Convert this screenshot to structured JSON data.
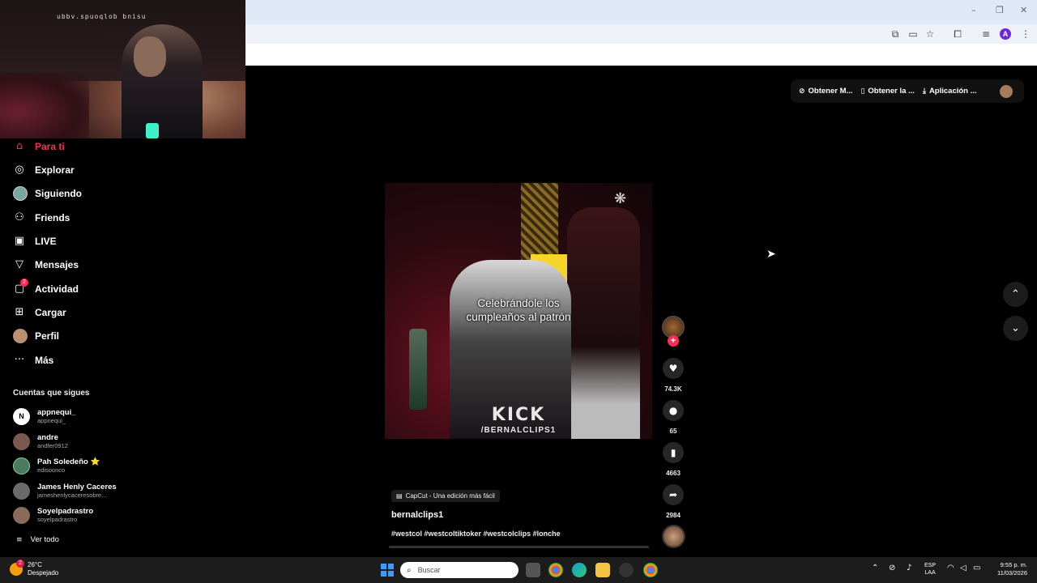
{
  "browser": {
    "window_controls": {
      "minimize": "–",
      "restore": "❐",
      "close": "✕"
    },
    "profile_initial": "A"
  },
  "webcam": {
    "overlay_text": "ubbv.spuoqlob bnisu"
  },
  "sidebar": {
    "items": [
      {
        "label": "Para ti",
        "icon": "home-icon",
        "active": true
      },
      {
        "label": "Explorar",
        "icon": "compass-icon"
      },
      {
        "label": "Siguiendo",
        "icon": "following-avatar-icon"
      },
      {
        "label": "Friends",
        "icon": "friends-icon"
      },
      {
        "label": "LIVE",
        "icon": "live-icon"
      },
      {
        "label": "Mensajes",
        "icon": "send-icon"
      },
      {
        "label": "Actividad",
        "icon": "activity-icon",
        "badge": "2"
      },
      {
        "label": "Cargar",
        "icon": "upload-icon"
      },
      {
        "label": "Perfil",
        "icon": "profile-avatar-icon"
      },
      {
        "label": "Más",
        "icon": "more-icon"
      }
    ],
    "following_title": "Cuentas que sigues",
    "accounts": [
      {
        "name": "appnequi_",
        "handle": "appnequi_",
        "avatar_text": "N"
      },
      {
        "name": "andre",
        "handle": "andfer0912"
      },
      {
        "name": "Pah Soledeño ⭐",
        "handle": "edisoonco"
      },
      {
        "name": "James Henly Caceres",
        "handle": "jameshenlycaceresobre..."
      },
      {
        "name": "Soyelpadrastro",
        "handle": "soyelpadrastro"
      }
    ],
    "see_all": "Ver todo"
  },
  "top_actions": {
    "get_coins": "Obtener M...",
    "get_app": "Obtener la ...",
    "pc_app": "Aplicación ..."
  },
  "video": {
    "caption": "Celebrándole los\ncumpleaños al patrón",
    "watermark_main": "KICK",
    "watermark_sub": "/BERNALCLIPS1",
    "capcut_label": "CapCut - Una edición más fácil",
    "author": "bernalclips1",
    "hashtags": "#westcol #westcoltiktoker #westcolclips #lonche",
    "progress": 0.0
  },
  "actions": {
    "likes": "74.3K",
    "comments": "65",
    "saves": "4663",
    "shares": "2984"
  },
  "taskbar": {
    "temperature": "26°C",
    "weather": "Despejado",
    "weather_badge": "2",
    "search_placeholder": "Buscar",
    "language_line1": "ESP",
    "language_line2": "LAA",
    "time": "9:55 p. m.",
    "date": "11/03/2026"
  }
}
